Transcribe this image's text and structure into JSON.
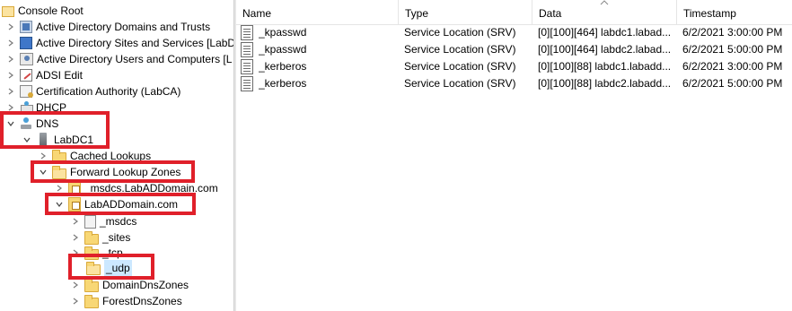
{
  "tree": {
    "items": [
      {
        "label": "Console Root",
        "icon": "console-root-icon"
      },
      {
        "label": "Active Directory Domains and Trusts",
        "icon": "domains-trusts-icon"
      },
      {
        "label": "Active Directory Sites and Services [LabD",
        "icon": "sites-services-icon"
      },
      {
        "label": "Active Directory Users and Computers [L",
        "icon": "users-computers-icon"
      },
      {
        "label": "ADSI Edit",
        "icon": "adsi-edit-icon"
      },
      {
        "label": "Certification Authority (LabCA)",
        "icon": "certificate-authority-icon"
      },
      {
        "label": "DHCP",
        "icon": "dhcp-icon"
      },
      {
        "label": "DNS",
        "icon": "dns-icon"
      },
      {
        "label": "LabDC1",
        "icon": "server-icon"
      },
      {
        "label": "Cached Lookups",
        "icon": "folder-icon"
      },
      {
        "label": "Forward Lookup Zones",
        "icon": "folder-open-icon"
      },
      {
        "label": "_msdcs.LabADDomain.com",
        "icon": "zone-icon"
      },
      {
        "label": "LabADDomain.com",
        "icon": "zone-icon"
      },
      {
        "label": "_msdcs",
        "icon": "zone-delegation-icon"
      },
      {
        "label": "_sites",
        "icon": "folder-icon"
      },
      {
        "label": "_tcp",
        "icon": "folder-icon"
      },
      {
        "label": "_udp",
        "icon": "folder-open-icon"
      },
      {
        "label": "DomainDnsZones",
        "icon": "folder-icon"
      },
      {
        "label": "ForestDnsZones",
        "icon": "folder-icon"
      }
    ]
  },
  "list": {
    "columns": [
      "Name",
      "Type",
      "Data",
      "Timestamp"
    ],
    "sorted_column": "Data",
    "rows": [
      {
        "name": "_kpasswd",
        "type": "Service Location (SRV)",
        "data": "[0][100][464] labdc1.labad...",
        "timestamp": "6/2/2021 3:00:00 PM"
      },
      {
        "name": "_kpasswd",
        "type": "Service Location (SRV)",
        "data": "[0][100][464] labdc2.labad...",
        "timestamp": "6/2/2021 5:00:00 PM"
      },
      {
        "name": "_kerberos",
        "type": "Service Location (SRV)",
        "data": "[0][100][88] labdc1.labadd...",
        "timestamp": "6/2/2021 3:00:00 PM"
      },
      {
        "name": "_kerberos",
        "type": "Service Location (SRV)",
        "data": "[0][100][88] labdc2.labadd...",
        "timestamp": "6/2/2021 5:00:00 PM"
      }
    ]
  },
  "colors": {
    "highlight": "#e0202a",
    "selection": "#cce8ff",
    "folder": "#f8d775"
  }
}
